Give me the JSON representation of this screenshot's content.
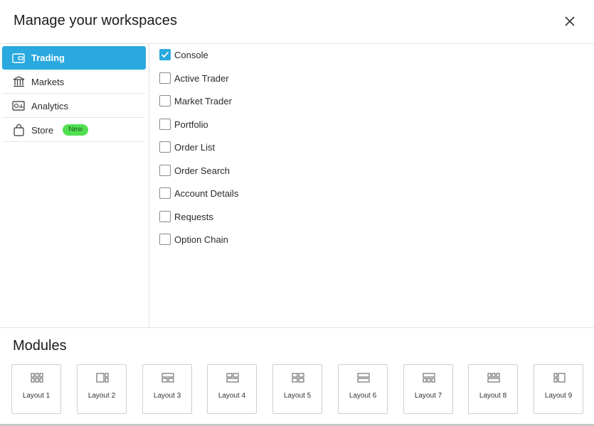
{
  "dialog": {
    "title": "Manage your workspaces"
  },
  "sidebar": {
    "items": [
      {
        "label": "Trading",
        "icon": "wallet-icon",
        "active": true
      },
      {
        "label": "Markets",
        "icon": "bank-icon",
        "active": false
      },
      {
        "label": "Analytics",
        "icon": "chart-card-icon",
        "active": false
      },
      {
        "label": "Store",
        "icon": "shopping-bag-icon",
        "active": false,
        "badge": "New"
      }
    ]
  },
  "workspaces": [
    {
      "label": "Console",
      "checked": true
    },
    {
      "label": "Active Trader",
      "checked": false
    },
    {
      "label": "Market Trader",
      "checked": false
    },
    {
      "label": "Portfolio",
      "checked": false
    },
    {
      "label": "Order List",
      "checked": false
    },
    {
      "label": "Order Search",
      "checked": false
    },
    {
      "label": "Account Details",
      "checked": false
    },
    {
      "label": "Requests",
      "checked": false
    },
    {
      "label": "Option Chain",
      "checked": false
    }
  ],
  "modules": {
    "title": "Modules",
    "layouts": [
      {
        "label": "Layout 1"
      },
      {
        "label": "Layout 2"
      },
      {
        "label": "Layout 3"
      },
      {
        "label": "Layout 4"
      },
      {
        "label": "Layout 5"
      },
      {
        "label": "Layout 6"
      },
      {
        "label": "Layout 7"
      },
      {
        "label": "Layout 8"
      },
      {
        "label": "Layout 9"
      }
    ]
  },
  "colors": {
    "accent": "#29a9df",
    "badge": "#52e052",
    "border": "#e4e4e4"
  }
}
